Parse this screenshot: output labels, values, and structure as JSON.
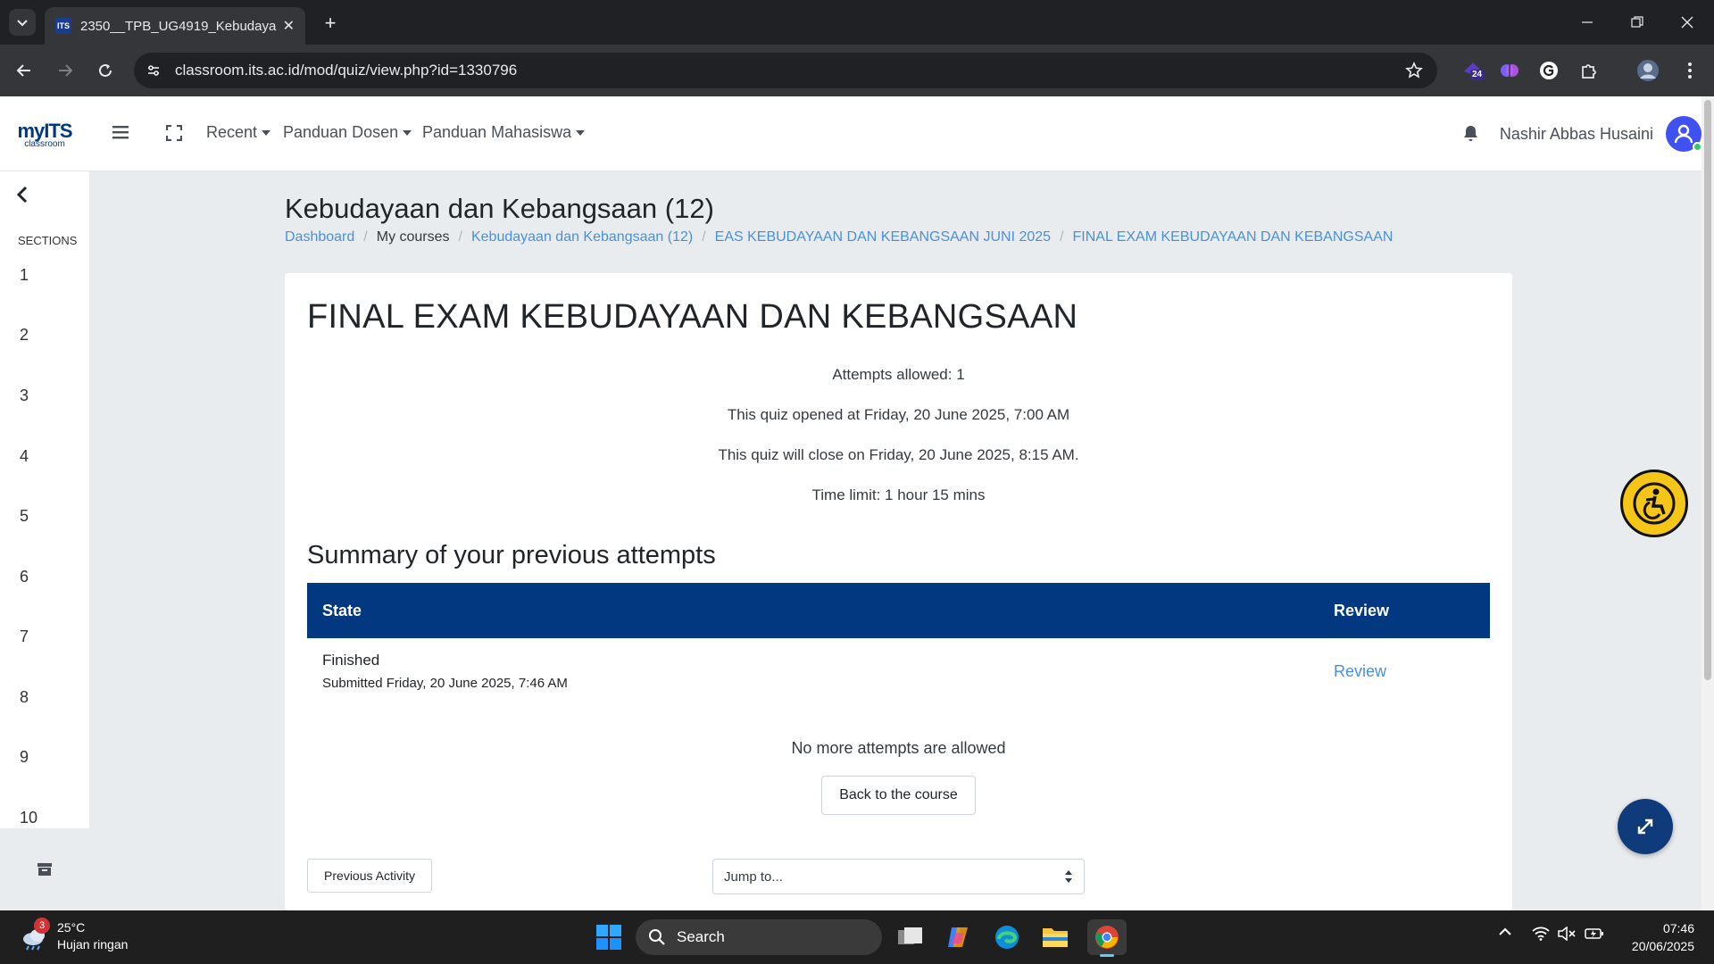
{
  "browser": {
    "tab_title": "2350__TPB_UG4919_Kebudaya",
    "tab_favicon": "ITS",
    "url": "classroom.its.ac.id/mod/quiz/view.php?id=1330796",
    "extension_badge": "24"
  },
  "navbar": {
    "logo_main": "myITS",
    "logo_sub": "classroom",
    "menu": [
      "Recent",
      "Panduan Dosen",
      "Panduan Mahasiswa"
    ],
    "user_name": "Nashir Abbas Husaini"
  },
  "sidebar": {
    "title": "SECTIONS",
    "sections": [
      "1",
      "2",
      "3",
      "4",
      "5",
      "6",
      "7",
      "8",
      "9",
      "10"
    ]
  },
  "page": {
    "heading": "Kebudayaan dan Kebangsaan (12)",
    "breadcrumb": [
      {
        "label": "Dashboard",
        "link": true
      },
      {
        "label": "My courses",
        "link": false
      },
      {
        "label": "Kebudayaan dan Kebangsaan (12)",
        "link": true
      },
      {
        "label": "EAS KEBUDAYAAN DAN KEBANGSAAN JUNI 2025",
        "link": true
      },
      {
        "label": "FINAL EXAM KEBUDAYAAN DAN KEBANGSAAN",
        "link": true
      }
    ]
  },
  "quiz": {
    "title": "FINAL EXAM KEBUDAYAAN DAN KEBANGSAAN",
    "attempts_allowed": "Attempts allowed: 1",
    "opened": "This quiz opened at Friday, 20 June 2025, 7:00 AM",
    "close": "This quiz will close on Friday, 20 June 2025, 8:15 AM.",
    "time_limit": "Time limit: 1 hour 15 mins",
    "summary_title": "Summary of your previous attempts",
    "table": {
      "headers": [
        "State",
        "Review"
      ],
      "rows": [
        {
          "state": "Finished",
          "submitted": "Submitted Friday, 20 June 2025, 7:46 AM",
          "review": "Review"
        }
      ]
    },
    "no_more": "No more attempts are allowed",
    "back_button": "Back to the course",
    "prev_activity": "Previous Activity",
    "jump_to": "Jump to..."
  },
  "taskbar": {
    "weather_temp": "25°C",
    "weather_desc": "Hujan ringan",
    "weather_badge": "3",
    "search_placeholder": "Search",
    "time": "07:46",
    "date": "20/06/2025"
  }
}
